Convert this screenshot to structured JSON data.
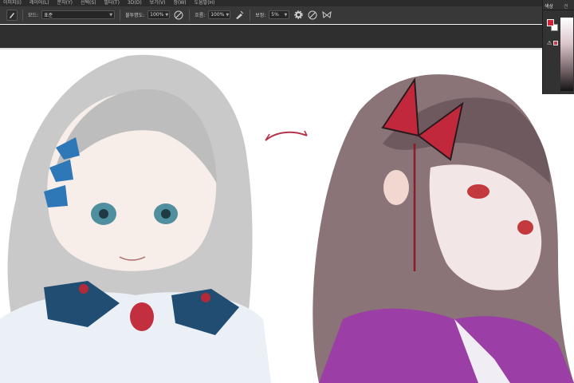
{
  "menu": {
    "items": [
      "이미지(I)",
      "레이어(L)",
      "문자(Y)",
      "선택(S)",
      "필터(T)",
      "3D(D)",
      "보기(V)",
      "창(W)",
      "도움말(H)"
    ]
  },
  "options": {
    "mode_label": "모드:",
    "mode_value": "표준",
    "opacity_label": "불투명도:",
    "opacity_value": "100%",
    "flow_label": "흐름:",
    "flow_value": "100%",
    "smoothing_label": "보정:",
    "smoothing_value": "5%"
  },
  "panel": {
    "tab_color": "색상",
    "tab_swatches": "견",
    "fg_color": "#d32234",
    "bg_color": "#ffffff"
  }
}
